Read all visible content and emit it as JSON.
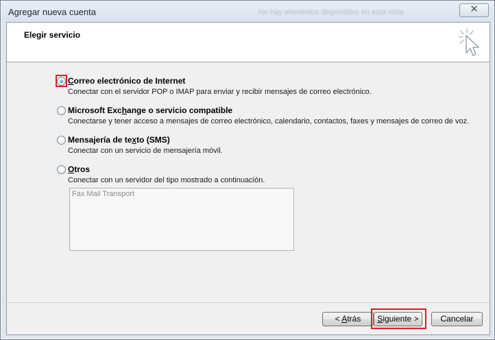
{
  "window": {
    "title": "Agregar nueva cuenta",
    "background_text": "No hay elementos disponibles en esta vista",
    "close_glyph": "✕"
  },
  "header": {
    "title": "Elegir servicio",
    "icon": "wizard-cursor-icon"
  },
  "options": [
    {
      "label_pre": "",
      "label_accel": "C",
      "label_post": "orreo electrónico de Internet",
      "description": "Conectar con el servidor POP o IMAP para enviar y recibir mensajes de correo electrónico.",
      "selected": true
    },
    {
      "label_pre": "Microsoft Exc",
      "label_accel": "h",
      "label_post": "ange o servicio compatible",
      "description": "Conectarse y tener acceso a mensajes de correo electrónico, calendario, contactos, faxes y mensajes de correo de voz.",
      "selected": false
    },
    {
      "label_pre": "Mensajería de te",
      "label_accel": "x",
      "label_post": "to (SMS)",
      "description": "Conectar con un servicio de mensajería móvil.",
      "selected": false
    },
    {
      "label_pre": "",
      "label_accel": "O",
      "label_post": "tros",
      "description": "Conectar con un servidor del tipo mostrado a continuación.",
      "selected": false
    }
  ],
  "server_list": {
    "items": [
      "Fax Mail Transport"
    ]
  },
  "buttons": {
    "back_pre": "< ",
    "back_accel": "A",
    "back_post": "trás",
    "next_pre": "",
    "next_accel": "S",
    "next_post": "iguiente >",
    "cancel": "Cancelar"
  },
  "colors": {
    "highlight": "#e01b24",
    "radio_dot": "#2c6fb3"
  }
}
